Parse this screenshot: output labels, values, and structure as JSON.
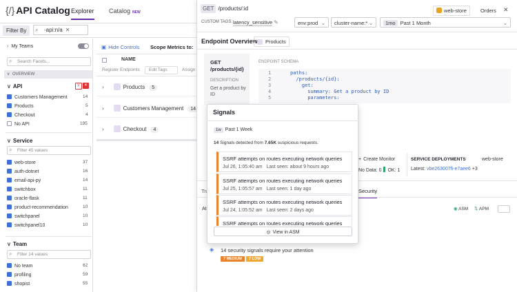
{
  "app": {
    "title": "API Catalog",
    "tabs": [
      "Explorer",
      "Catalog"
    ],
    "new_badge": "NEW"
  },
  "filter": {
    "label": "Filter By",
    "chip": "-api:n/a"
  },
  "sidebar": {
    "my_teams": "My Teams",
    "search_facets": "Search Facets...",
    "overview": "OVERVIEW",
    "api": {
      "title": "API",
      "items": [
        {
          "label": "Customers Management",
          "count": "14",
          "on": true
        },
        {
          "label": "Products",
          "count": "5",
          "on": true
        },
        {
          "label": "Checkout",
          "count": "4",
          "on": true
        },
        {
          "label": "No API",
          "count": "195",
          "on": false
        }
      ]
    },
    "service": {
      "title": "Service",
      "placeholder": "Filter 45 values",
      "items": [
        {
          "label": "web-store",
          "count": "37"
        },
        {
          "label": "auth-dotnet",
          "count": "16"
        },
        {
          "label": "email-api-py",
          "count": "14"
        },
        {
          "label": "switchbox",
          "count": "11"
        },
        {
          "label": "oracle-flask",
          "count": "11"
        },
        {
          "label": "product-recommendation",
          "count": "10"
        },
        {
          "label": "switchpanel",
          "count": "10"
        },
        {
          "label": "switchpanel10",
          "count": "10"
        }
      ]
    },
    "team": {
      "title": "Team",
      "placeholder": "Filter 14 values",
      "items": [
        {
          "label": "No team",
          "count": "62"
        },
        {
          "label": "profiling",
          "count": "59"
        },
        {
          "label": "shopist",
          "count": "55"
        }
      ]
    }
  },
  "main": {
    "hide_controls": "Hide Controls",
    "scope": "Scope Metrics to:",
    "col_name": "NAME",
    "register": "Register Endpoints",
    "edit_tags": "Edit Tags",
    "assign": "Assign",
    "rows": [
      {
        "label": "Products",
        "count": "5"
      },
      {
        "label": "Customers Management",
        "count": "14"
      },
      {
        "label": "Checkout",
        "count": "4"
      }
    ]
  },
  "panel": {
    "method": "GET",
    "path": "/products/:id",
    "service_badge": "web-store",
    "orders": "Orders",
    "custom_tags_label": "CUSTOM TAGS:",
    "custom_tag": "latency_sensitive",
    "env": "env:prod",
    "cluster": "cluster-name:*",
    "time_short": "1mo",
    "time_long": "Past 1 Month",
    "overview_title": "Endpoint Overview",
    "products_chip": "Products",
    "left_method": "GET",
    "left_path": "/products/{id}",
    "desc_label": "DESCRIPTION",
    "desc": "Get a product by ID",
    "schema_label": "ENDPOINT SCHEMA",
    "code": [
      {
        "n": "1",
        "t": "paths:"
      },
      {
        "n": "2",
        "t": "  /products/{id}:"
      },
      {
        "n": "3",
        "t": "    get:"
      },
      {
        "n": "4",
        "t": "      summary: Get a product by ID"
      },
      {
        "n": "5",
        "t": "      parameters:"
      }
    ],
    "create_monitor": "Create Monitor",
    "no_data": "No Data: 0",
    "ok": "OK: 1",
    "deploy_title": "SERVICE DEPLOYMENTS",
    "deploy_service": "web-store",
    "latest_label": "Latest:",
    "latest_hash": "vbe263007fi-e7aee6",
    "latest_more": "+3",
    "tab_tr": "Tra",
    "tab_security": "Security",
    "at": "At",
    "asm": "ASM",
    "apm": "APM",
    "security_msg": "14 security signals require your attention",
    "medium": "7 MEDIUM",
    "low": "7 LOW"
  },
  "popup": {
    "title": "Signals",
    "time_short": "1w",
    "time_long": "Past 1 Week",
    "summary_count": "14",
    "summary_mid": "Signals detected from",
    "summary_num": "7.65K",
    "summary_end": "suspicious requests.",
    "signals": [
      {
        "title": "SSRF attempts on routes executing network queries",
        "date": "Jul 26, 1:05:40 am",
        "seen": "Last seen: about 9 hours ago"
      },
      {
        "title": "SSRF attempts on routes executing network queries",
        "date": "Jul 25, 1:05:57 am",
        "seen": "Last seen: 1 day ago"
      },
      {
        "title": "SSRF attempts on routes executing network queries",
        "date": "Jul 24, 1:05:52 am",
        "seen": "Last seen: 2 days ago"
      },
      {
        "title": "SSRF attempts on routes executing network queries",
        "date": "",
        "seen": ""
      }
    ],
    "view_btn": "View in ASM"
  },
  "colors": {
    "accent": "#632ca6",
    "check": "#3d71d9",
    "signal": "#e8822b",
    "medium": "#e8822b",
    "low": "#f0a830"
  }
}
